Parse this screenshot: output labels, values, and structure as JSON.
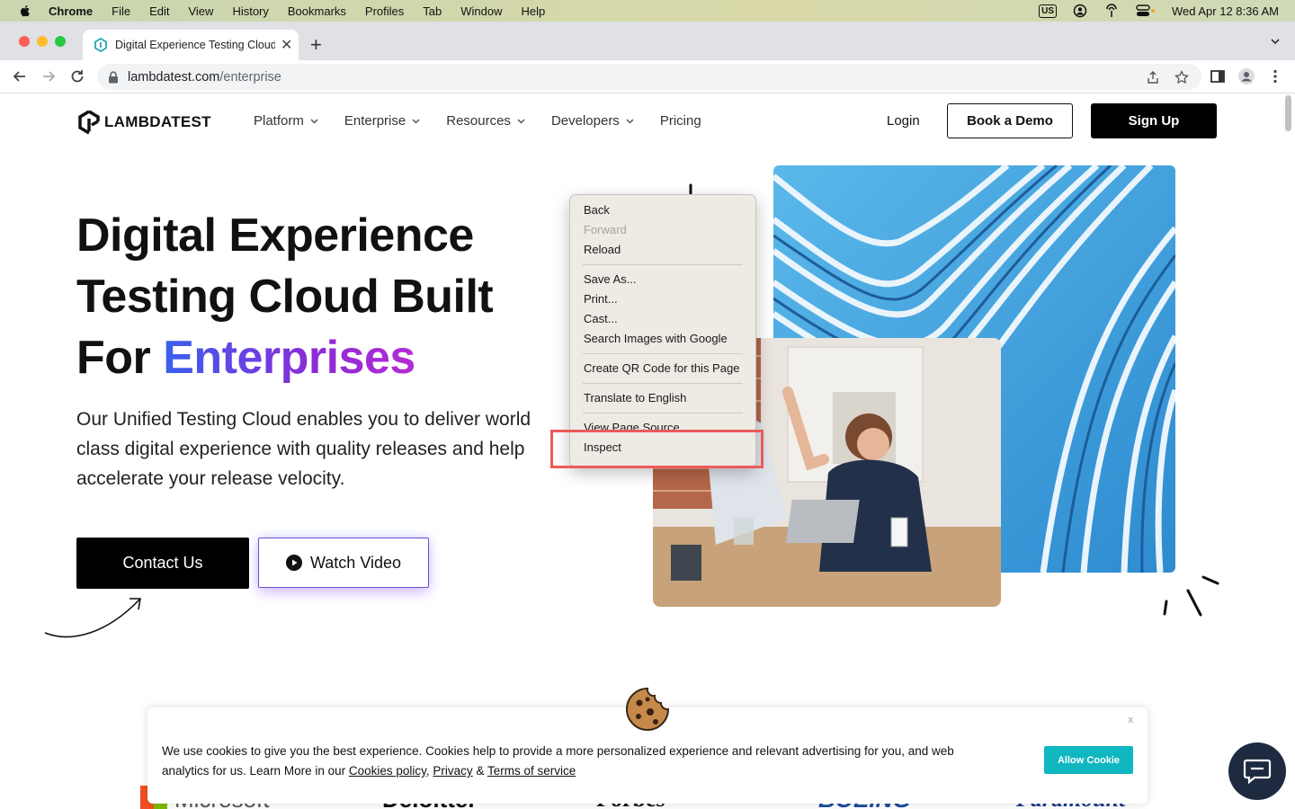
{
  "menubar": {
    "app": "Chrome",
    "items": [
      "File",
      "Edit",
      "View",
      "History",
      "Bookmarks",
      "Profiles",
      "Tab",
      "Window",
      "Help"
    ],
    "input_badge": "US",
    "clock": "Wed Apr 12  8:36 AM"
  },
  "tab": {
    "title": "Digital Experience Testing Cloud"
  },
  "omnibox": {
    "host": "lambdatest.com",
    "path": "/enterprise"
  },
  "site": {
    "logo": "LAMBDATEST",
    "nav": [
      "Platform",
      "Enterprise",
      "Resources",
      "Developers",
      "Pricing"
    ],
    "login": "Login",
    "book_demo": "Book a Demo",
    "sign_up": "Sign Up"
  },
  "hero": {
    "line1": "Digital Experience",
    "line2": "Testing Cloud Built",
    "line3_prefix": "For ",
    "line3_highlight": "Enterprises",
    "subtitle": "Our Unified Testing Cloud enables you to deliver world class digital experience with quality releases and help accelerate your release velocity.",
    "contact": "Contact Us",
    "watch": "Watch Video"
  },
  "context_menu": {
    "back": "Back",
    "forward": "Forward",
    "reload": "Reload",
    "save_as": "Save As...",
    "print": "Print...",
    "cast": "Cast...",
    "search_images": "Search Images with Google",
    "qr": "Create QR Code for this Page",
    "translate": "Translate to English",
    "view_source": "View Page Source",
    "inspect": "Inspect"
  },
  "cookie": {
    "text_1": "We use cookies to give you the best experience. Cookies help to provide a more personalized experience and relevant advertising for you, and web analytics for us. Learn More in our ",
    "policy": "Cookies policy",
    "comma": ", ",
    "privacy": "Privacy",
    "amp": " & ",
    "terms": "Terms of service",
    "close": "x",
    "allow": "Allow Cookie"
  },
  "customer_logos": [
    "Microsoft",
    "Deloitte.",
    "Forbes",
    "BOEING",
    "Paramount"
  ],
  "colors": {
    "accent_teal": "#10b7c1",
    "highlight_red": "#ee5a5a",
    "grad_start": "#3a5ff0",
    "grad_end": "#b52bd4"
  }
}
